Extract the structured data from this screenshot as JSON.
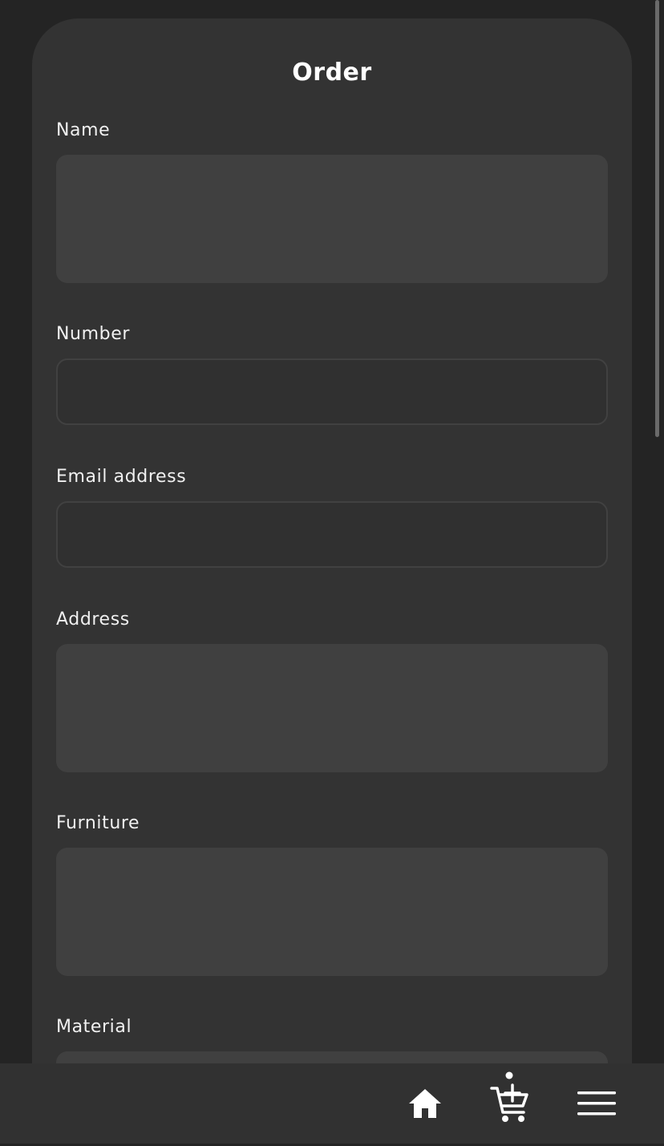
{
  "form": {
    "title": "Order",
    "fields": [
      {
        "label": "Name",
        "value": ""
      },
      {
        "label": "Number",
        "value": ""
      },
      {
        "label": "Email address",
        "value": ""
      },
      {
        "label": "Address",
        "value": ""
      },
      {
        "label": "Furniture",
        "value": ""
      },
      {
        "label": "Material",
        "value": ""
      }
    ]
  },
  "bottom_nav": {
    "items": [
      {
        "icon": "home-icon"
      },
      {
        "icon": "add-to-cart-icon"
      },
      {
        "icon": "menu-icon"
      }
    ]
  },
  "colors": {
    "background": "#242424",
    "card": "#333333",
    "input_filled": "#404040",
    "input_border": "#414141",
    "text": "#ffffff"
  }
}
